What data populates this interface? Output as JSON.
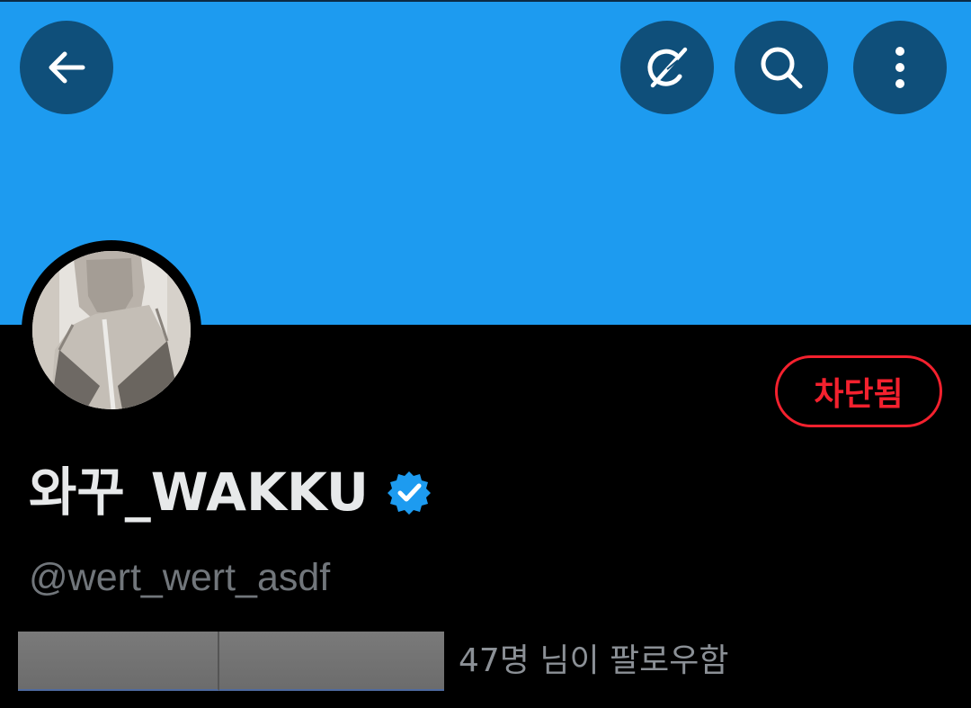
{
  "header": {
    "back_icon": "arrow-left-icon",
    "grok_icon": "grok-icon",
    "search_icon": "search-icon",
    "more_icon": "more-vertical-icon",
    "banner_color": "#1d9bf0",
    "button_color": "#0f4f7a"
  },
  "profile": {
    "display_name": "와꾸_WAKKU",
    "verified": true,
    "verified_icon": "verified-badge-icon",
    "handle": "@wert_wert_asdf",
    "blocked_label": "차단됨",
    "blocked_color": "#f4212e"
  },
  "followers": {
    "text": "47명 님이 팔로우함"
  }
}
